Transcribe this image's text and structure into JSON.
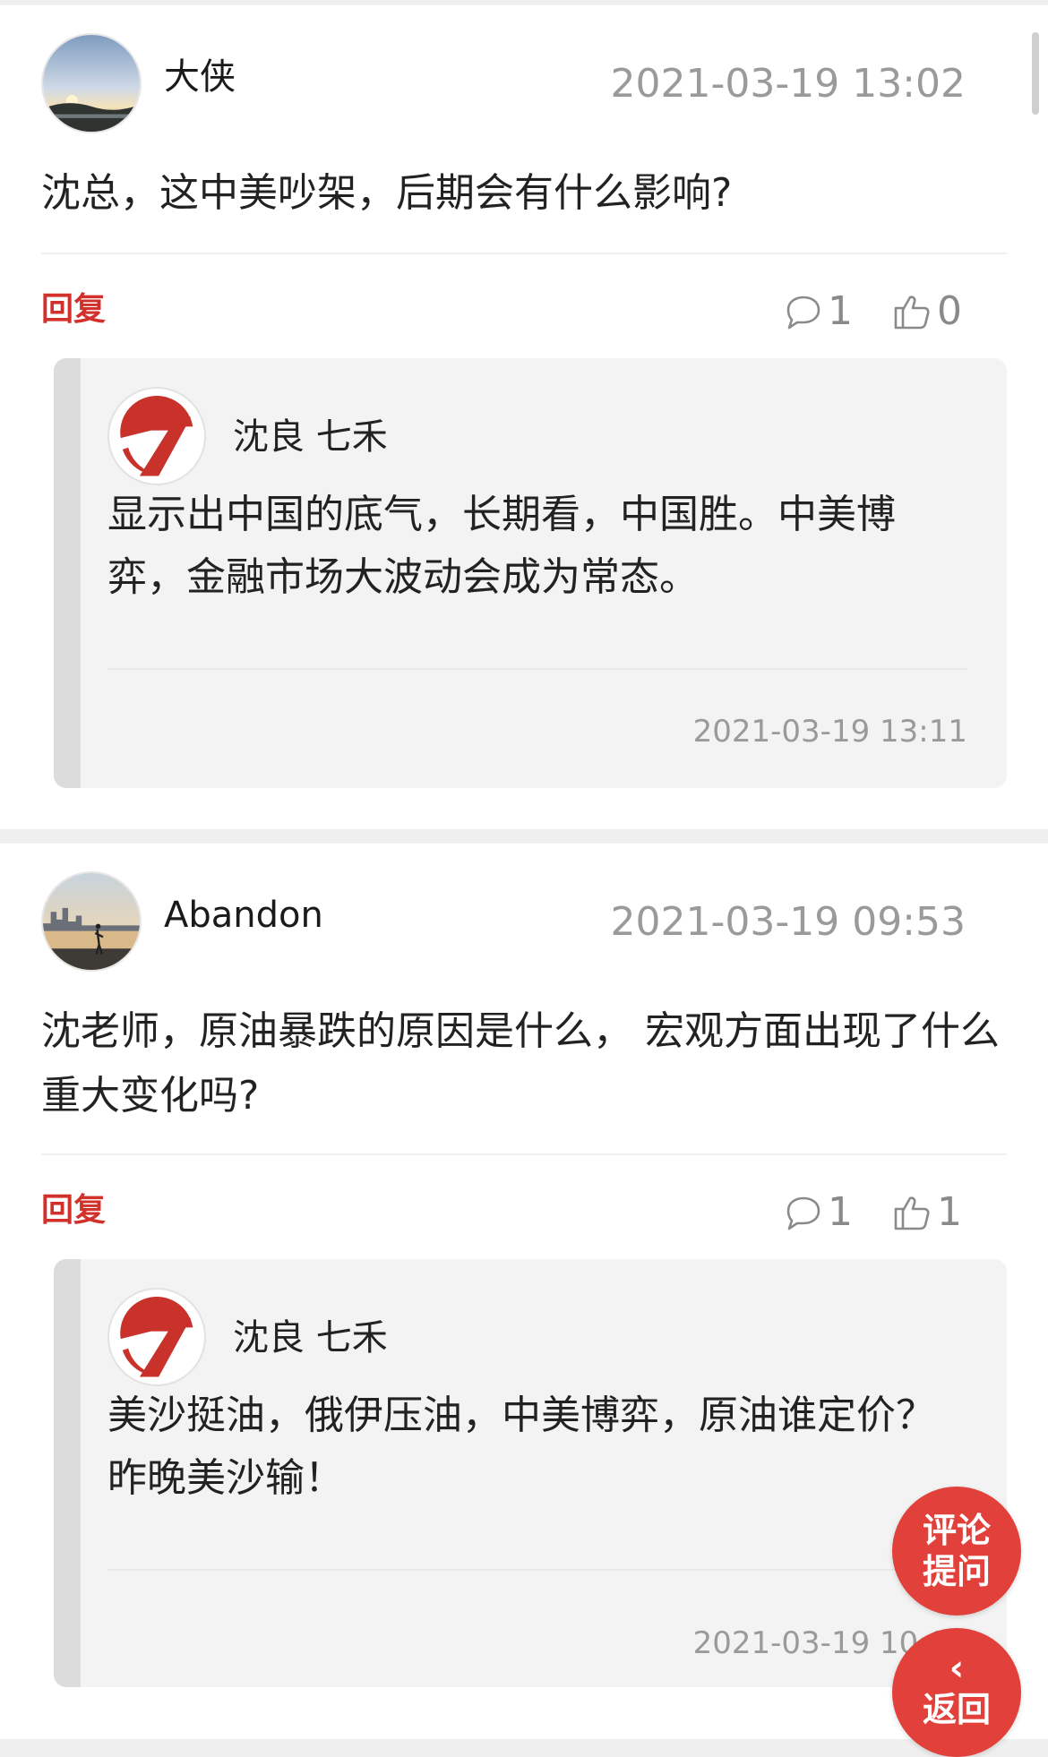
{
  "comments": [
    {
      "username": "大侠",
      "time": "2021-03-19 13:02",
      "content": "沈总，这中美吵架，后期会有什么影响?",
      "reply_label": "回复",
      "comment_count": "1",
      "like_count": "0",
      "avatar_icon": "sunset-landscape-avatar",
      "reply": {
        "name": "沈良 七禾",
        "content": "显示出中国的底气，长期看，中国胜。中美博弈，金融市场大波动会成为常态。",
        "time": "2021-03-19 13:11",
        "avatar_icon": "qihe-7-logo"
      }
    },
    {
      "username": "Abandon",
      "time": "2021-03-19 09:53",
      "content": "沈老师，原油暴跌的原因是什么， 宏观方面出现了什么重大变化吗?",
      "reply_label": "回复",
      "comment_count": "1",
      "like_count": "1",
      "avatar_icon": "city-skyline-avatar",
      "reply": {
        "name": "沈良 七禾",
        "content": "美沙挺油，俄伊压油，中美博弈，原油谁定价？昨晚美沙输！",
        "time": "2021-03-19 10:01",
        "avatar_icon": "qihe-7-logo"
      }
    }
  ],
  "fab": {
    "comment_line1": "评论",
    "comment_line2": "提问",
    "back_icon": "‹",
    "back_label": "返回"
  },
  "colors": {
    "accent": "#d2312b",
    "fab": "#e2403a",
    "muted": "#9a9a9a"
  }
}
